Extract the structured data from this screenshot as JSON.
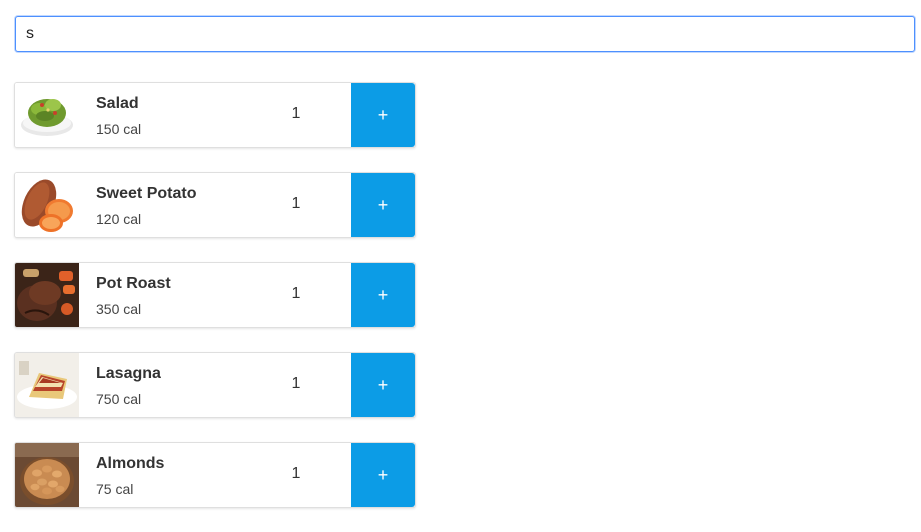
{
  "search": {
    "value": "s",
    "placeholder": ""
  },
  "foods": [
    {
      "name": "Salad",
      "calories": "150 cal",
      "quantity": "1",
      "add_label": "+",
      "image": "salad-image"
    },
    {
      "name": "Sweet Potato",
      "calories": "120 cal",
      "quantity": "1",
      "add_label": "+",
      "image": "sweet-potato-image"
    },
    {
      "name": "Pot Roast",
      "calories": "350 cal",
      "quantity": "1",
      "add_label": "+",
      "image": "pot-roast-image"
    },
    {
      "name": "Lasagna",
      "calories": "750 cal",
      "quantity": "1",
      "add_label": "+",
      "image": "lasagna-image"
    },
    {
      "name": "Almonds",
      "calories": "75 cal",
      "quantity": "1",
      "add_label": "+",
      "image": "almonds-image"
    }
  ],
  "colors": {
    "accent": "#0c9ce6",
    "focus_border": "#4d90fe"
  }
}
